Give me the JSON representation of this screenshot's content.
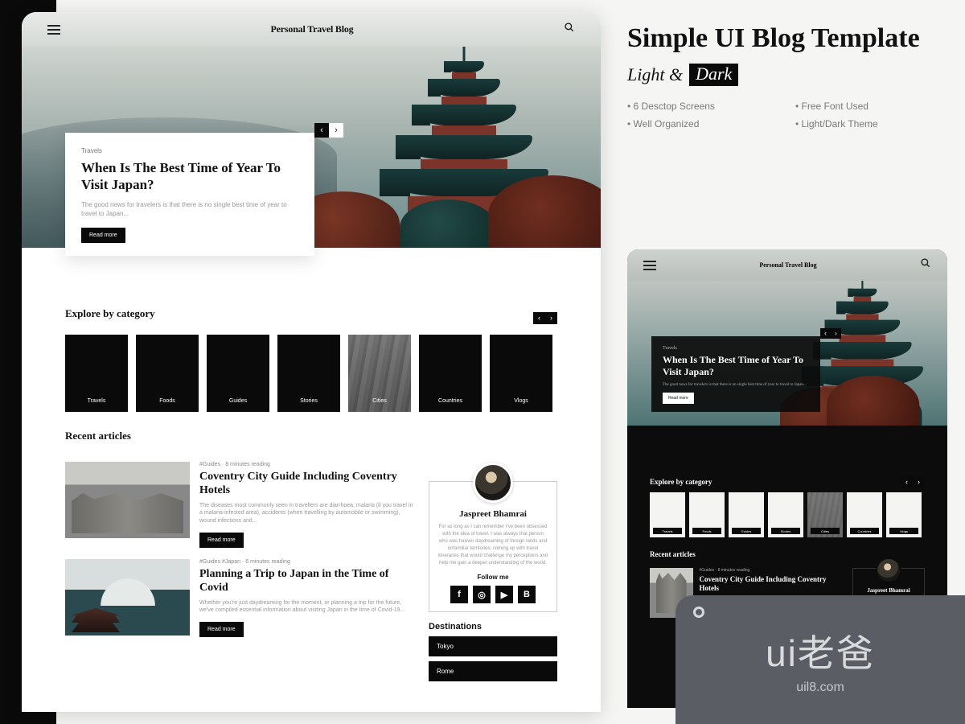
{
  "promo": {
    "title": "Simple UI Blog Template",
    "theme_light": "Light &",
    "theme_dark": "Dark",
    "features": [
      "6 Desctop Screens",
      "Free Font Used",
      "Well Organized",
      "Light/Dark Theme"
    ]
  },
  "header": {
    "site_title": "Personal Travel Blog"
  },
  "hero": {
    "category": "Travels",
    "title": "When Is The Best Time of Year To Visit Japan?",
    "excerpt": "The good news for travelers is that there is no single best time of year to travel to Japan...",
    "cta": "Read more"
  },
  "explore": {
    "heading": "Explore by category",
    "categories": [
      "Travels",
      "Foods",
      "Guides",
      "Stories",
      "Cities",
      "Countries",
      "Vlogs"
    ]
  },
  "recent": {
    "heading": "Recent articles",
    "articles": [
      {
        "meta": "#Guides  ·  8 minutes reading",
        "title": "Coventry City Guide Including Coventry Hotels",
        "excerpt": "The diseases most commonly seen in travellers are diarrhoea, malaria (if you travel in a malaria-infested area), accidents (when travelling by automobile or swimming), wound infections and...",
        "cta": "Read more"
      },
      {
        "meta": "#Guides  #Japan  ·  6 minutes reading",
        "title": "Planning a Trip to Japan in the Time of Covid",
        "excerpt": "Whether you're just daydreaming for the moment, or planning a trip for the future, we've compiled essential information about visiting Japan in the time of Covid-19...",
        "cta": "Read more"
      }
    ]
  },
  "author": {
    "name": "Jaspreet Bhamrai",
    "bio": "For as long as I can remember I've been obsessed with the idea of travel. I was always that person who was forever daydreaming of foreign lands and unfamiliar territories; coming up with travel itineraries that would challenge my perceptions and help me gain a deeper understanding of the world.",
    "follow": "Follow me"
  },
  "destinations": {
    "heading": "Destinations",
    "items": [
      "Tokyo",
      "Rome"
    ]
  },
  "watermark": {
    "logo_a": "ui",
    "logo_b": "老爸",
    "url": "uil8.com"
  }
}
